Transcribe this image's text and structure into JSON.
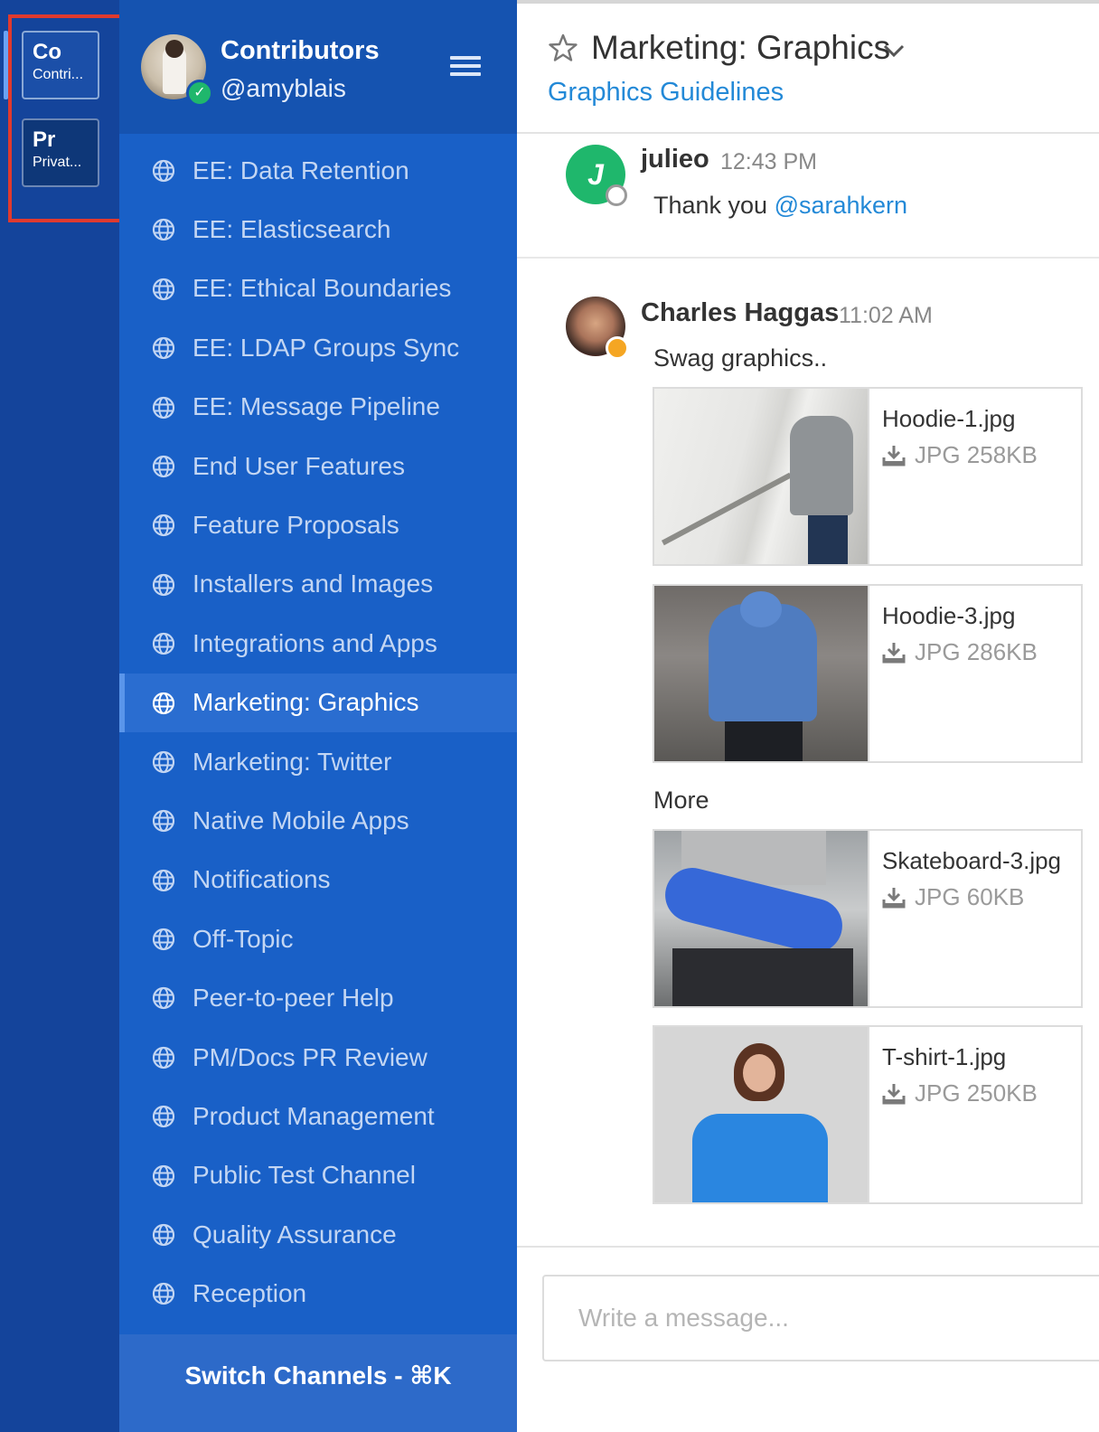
{
  "teams": [
    {
      "initials": "Co",
      "name": "Contri..."
    },
    {
      "initials": "Pr",
      "name": "Privat..."
    }
  ],
  "header": {
    "team_name": "Contributors",
    "username": "@amyblais"
  },
  "channels": [
    {
      "label": "EE: Data Retention"
    },
    {
      "label": "EE: Elasticsearch"
    },
    {
      "label": "EE: Ethical Boundaries"
    },
    {
      "label": "EE: LDAP Groups Sync"
    },
    {
      "label": "EE: Message Pipeline"
    },
    {
      "label": "End User Features"
    },
    {
      "label": "Feature Proposals"
    },
    {
      "label": "Installers and Images"
    },
    {
      "label": "Integrations and Apps"
    },
    {
      "label": "Marketing: Graphics"
    },
    {
      "label": "Marketing: Twitter"
    },
    {
      "label": "Native Mobile Apps"
    },
    {
      "label": "Notifications"
    },
    {
      "label": "Off-Topic"
    },
    {
      "label": "Peer-to-peer Help"
    },
    {
      "label": "PM/Docs PR Review"
    },
    {
      "label": "Product Management"
    },
    {
      "label": "Public Test Channel"
    },
    {
      "label": "Quality Assurance"
    },
    {
      "label": "Reception"
    }
  ],
  "active_channel_index": 9,
  "switch_channels_label": "Switch Channels - ⌘K",
  "channel_header": {
    "title": "Marketing: Graphics",
    "purpose": "Graphics Guidelines"
  },
  "posts": [
    {
      "avatar_initial": "J",
      "author": "julieo",
      "time": "12:43 PM",
      "text": "Thank you ",
      "mention": "@sarahkern"
    },
    {
      "author": "Charles Haggas",
      "time": "11:02 AM",
      "text": "Swag graphics..",
      "more_text": "More",
      "files": [
        {
          "name": "Hoodie-1.jpg",
          "meta": "JPG 258KB"
        },
        {
          "name": "Hoodie-3.jpg",
          "meta": "JPG 286KB"
        },
        {
          "name": "Skateboard-3.jpg",
          "meta": "JPG 60KB"
        },
        {
          "name": "T-shirt-1.jpg",
          "meta": "JPG 250KB"
        }
      ]
    }
  ],
  "composer": {
    "placeholder": "Write a message..."
  },
  "colors": {
    "team_sidebar": "#14449b",
    "channel_sidebar": "#1960c7",
    "active_channel": "#2a6dd0",
    "link": "#2389d7",
    "online": "#1fb76c",
    "dnd": "#f5a623",
    "highlight_box": "#e03a2e"
  }
}
